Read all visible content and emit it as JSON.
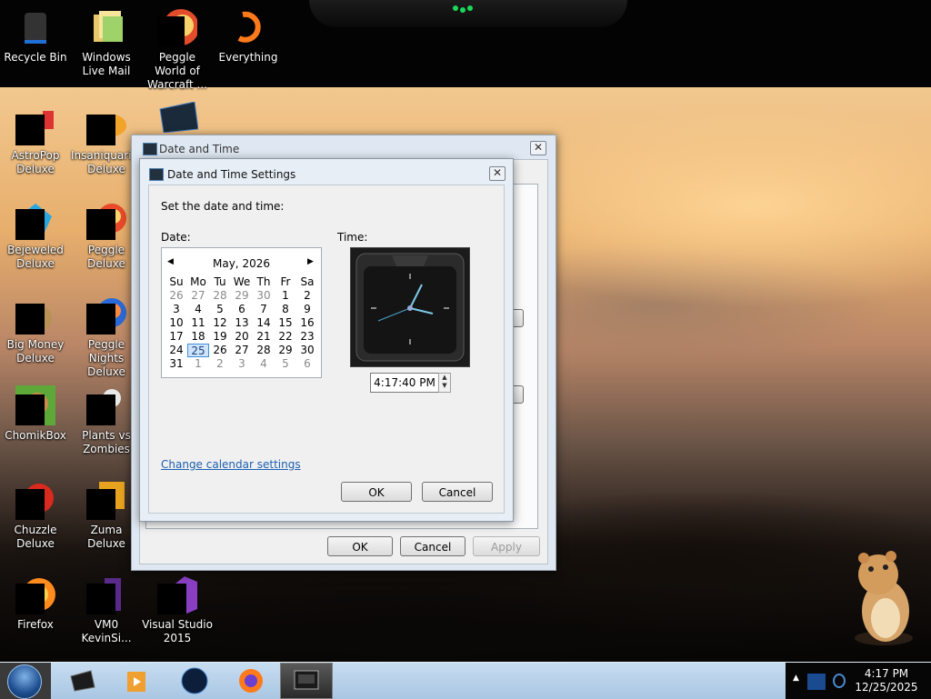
{
  "desktop_icons": [
    {
      "label": "Recycle Bin",
      "icon": "recycle-bin-icon"
    },
    {
      "label": "Windows Live Mail",
      "icon": "mail-icon"
    },
    {
      "label": "Peggle World of Warcraft ...",
      "icon": "peggle-icon"
    },
    {
      "label": "Everything",
      "icon": "search-icon"
    },
    {
      "label": "AstroPop Deluxe",
      "icon": "game-icon"
    },
    {
      "label": "Insaniquarium Deluxe",
      "icon": "fish-icon"
    },
    {
      "label": "Bejeweled Deluxe",
      "icon": "gem-icon"
    },
    {
      "label": "Peggle Deluxe",
      "icon": "peggle-icon"
    },
    {
      "label": "Big Money Deluxe",
      "icon": "money-bag-icon"
    },
    {
      "label": "Peggle Nights Deluxe",
      "icon": "peggle-icon"
    },
    {
      "label": "ChomikBox",
      "icon": "hamster-icon"
    },
    {
      "label": "Plants vs Zombies",
      "icon": "plant-icon"
    },
    {
      "label": "Chuzzle Deluxe",
      "icon": "game-icon"
    },
    {
      "label": "Zuma Deluxe",
      "icon": "frog-icon"
    },
    {
      "label": "Firefox",
      "icon": "firefox-icon"
    },
    {
      "label": "VM0 KevinSi...",
      "icon": "vm-icon"
    },
    {
      "label": "Visual Studio 2015",
      "icon": "visual-studio-icon"
    }
  ],
  "outer_window": {
    "title": "Date and Time",
    "ok_label": "OK",
    "cancel_label": "Cancel",
    "apply_label": "Apply"
  },
  "inner_window": {
    "title": "Date and Time Settings",
    "instruction": "Set the date and time:",
    "date_label": "Date:",
    "time_label": "Time:",
    "calendar": {
      "month_label": "May, 2026",
      "weekdays": [
        "Su",
        "Mo",
        "Tu",
        "We",
        "Th",
        "Fr",
        "Sa"
      ],
      "weeks": [
        [
          "26",
          "27",
          "28",
          "29",
          "30",
          "1",
          "2"
        ],
        [
          "3",
          "4",
          "5",
          "6",
          "7",
          "8",
          "9"
        ],
        [
          "10",
          "11",
          "12",
          "13",
          "14",
          "15",
          "16"
        ],
        [
          "17",
          "18",
          "19",
          "20",
          "21",
          "22",
          "23"
        ],
        [
          "24",
          "25",
          "26",
          "27",
          "28",
          "29",
          "30"
        ],
        [
          "31",
          "1",
          "2",
          "3",
          "4",
          "5",
          "6"
        ]
      ],
      "selected_day": "25"
    },
    "time_value": "4:17:40 PM",
    "change_calendar_link": "Change calendar settings",
    "ok_label": "OK",
    "cancel_label": "Cancel"
  },
  "taskbar": {
    "clock_time": "4:17 PM",
    "clock_date": "12/25/2025",
    "items": [
      "start-menu",
      "app-1",
      "media-player",
      "globe-app",
      "firefox",
      "date-time-settings"
    ]
  },
  "colors": {
    "link": "#1b5fb1",
    "selection": "#3f8fd8",
    "taskbar": "#b9d2ea"
  }
}
